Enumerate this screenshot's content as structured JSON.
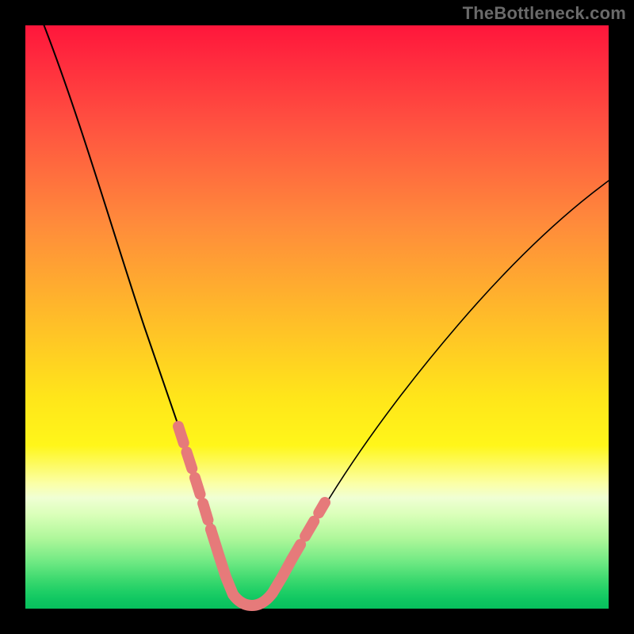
{
  "watermark": "TheBottleneck.com",
  "colors": {
    "frame": "#000000",
    "gradient_top": "#ff163b",
    "gradient_bottom": "#07c05d",
    "curve": "#000000",
    "marker": "#e67a7a"
  },
  "chart_data": {
    "type": "line",
    "title": "",
    "xlabel": "",
    "ylabel": "",
    "xlim": [
      0,
      100
    ],
    "ylim": [
      0,
      100
    ],
    "series": [
      {
        "name": "bottleneck-curve",
        "x": [
          2,
          5,
          8,
          11,
          14,
          17,
          20,
          22,
          24,
          26,
          28,
          30,
          31,
          32,
          33,
          34,
          35,
          36,
          38,
          40,
          44,
          48,
          52,
          56,
          60,
          66,
          72,
          80,
          90,
          100
        ],
        "y": [
          100,
          90,
          80,
          70,
          61,
          52,
          43,
          37,
          31,
          25,
          19,
          13,
          10,
          7,
          4,
          2,
          1,
          0,
          0,
          1,
          4,
          9,
          15,
          21,
          27,
          35,
          43,
          52,
          61,
          69
        ]
      }
    ],
    "highlight_segments": [
      {
        "name": "left-steep-dash",
        "x_range": [
          20,
          28
        ],
        "style": "dashed"
      },
      {
        "name": "valley-solid",
        "x_range": [
          28,
          45
        ],
        "style": "solid"
      },
      {
        "name": "right-rise-dash",
        "x_range": [
          45,
          50
        ],
        "style": "dashed"
      }
    ],
    "annotations": []
  }
}
